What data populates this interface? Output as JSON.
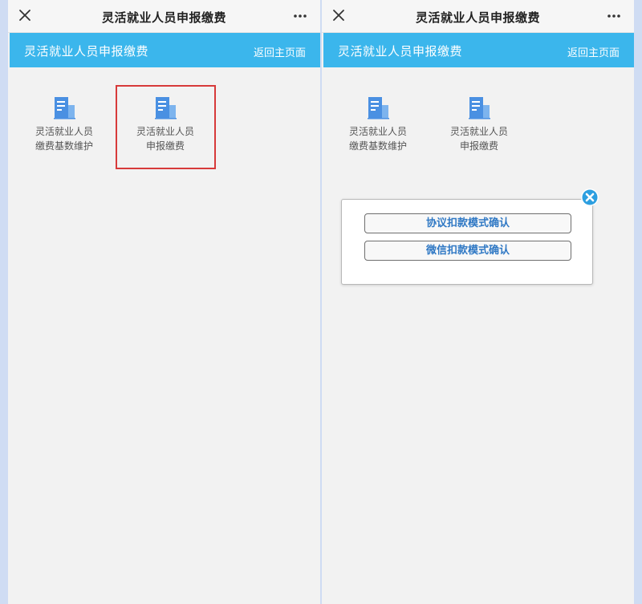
{
  "window": {
    "title": "灵活就业人员申报缴费"
  },
  "header": {
    "title": "灵活就业人员申报缴费",
    "back_link": "返回主页面"
  },
  "tiles": [
    {
      "line1": "灵活就业人员",
      "line2": "缴费基数维护",
      "icon": "document-building-icon"
    },
    {
      "line1": "灵活就业人员",
      "line2": "申报缴费",
      "icon": "document-building-icon"
    }
  ],
  "dialog": {
    "option_agreement": "协议扣款模式确认",
    "option_wechat": "微信扣款模式确认"
  },
  "colors": {
    "header_bg": "#3bb6ec",
    "highlight": "#d73a3a",
    "icon_blue": "#4a90e2",
    "button_text": "#2f78c4"
  }
}
